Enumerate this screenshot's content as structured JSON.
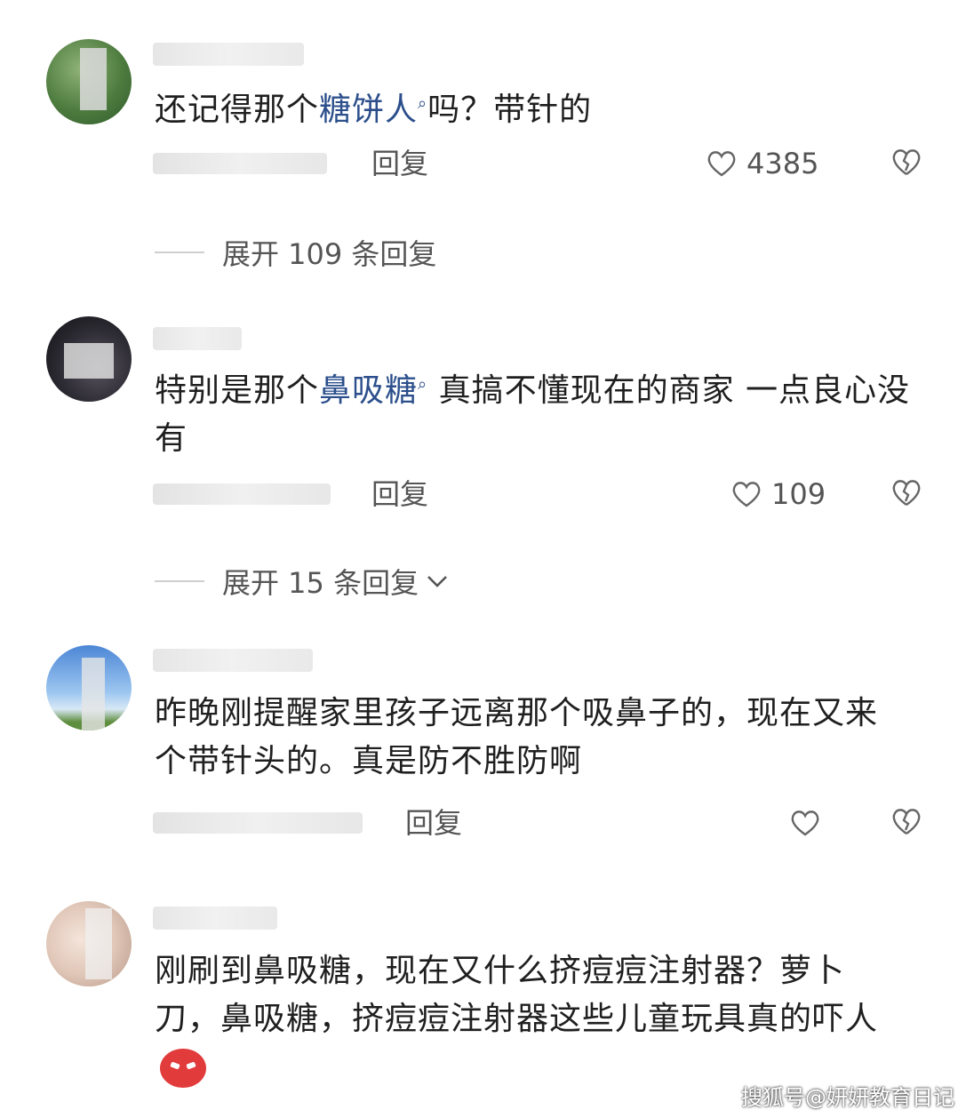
{
  "comments": [
    {
      "text_before": "还记得那个",
      "highlight": "糖饼人",
      "text_after": "吗？带针的",
      "reply_label": "回复",
      "like_count": "4385",
      "expand_label": "展开 109 条回复"
    },
    {
      "text_before": "特别是那个",
      "highlight": "鼻吸糖",
      "text_after": " 真搞不懂现在的商家  一点良心没有",
      "reply_label": "回复",
      "like_count": "109",
      "expand_label": "展开 15 条回复"
    },
    {
      "text": "昨晚刚提醒家里孩子远离那个吸鼻子的，现在又来个带针头的。真是防不胜防啊",
      "reply_label": "回复",
      "like_count": ""
    },
    {
      "text": "刚刷到鼻吸糖，现在又什么挤痘痘注射器？萝卜刀，鼻吸糖，挤痘痘注射器这些儿童玩具真的吓人"
    }
  ],
  "watermark": "搜狐号@妍妍教育日记",
  "icons": {
    "search": "search-icon",
    "like": "heart-icon",
    "dislike": "broken-heart-icon",
    "expand": "chevron-down-icon",
    "emoji": "angry-face-icon"
  }
}
